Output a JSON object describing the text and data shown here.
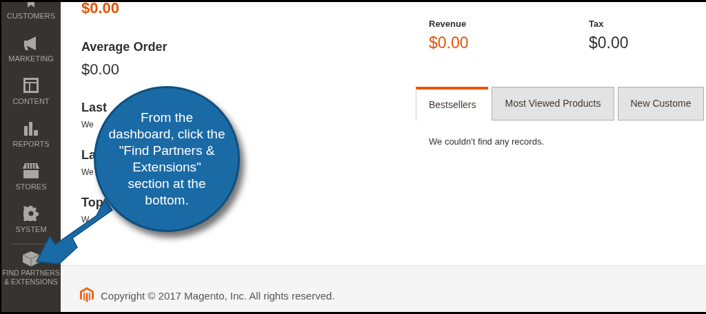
{
  "sidebar": {
    "items": [
      {
        "label": "CUSTOMERS",
        "selected": false
      },
      {
        "label": "MARKETING",
        "selected": false
      },
      {
        "label": "CONTENT",
        "selected": false
      },
      {
        "label": "REPORTS",
        "selected": false
      },
      {
        "label": "STORES",
        "selected": false
      },
      {
        "label": "SYSTEM",
        "selected": false
      }
    ],
    "footer_item": {
      "label": "FIND PARTNERS\n& EXTENSIONS"
    }
  },
  "totals_top": {
    "value": "$0.00"
  },
  "average_order": {
    "title": "Average Order",
    "value": "$0.00"
  },
  "sections": [
    {
      "title": "Last",
      "note": "We"
    },
    {
      "title": "La",
      "note": "We"
    },
    {
      "title": "Top",
      "note": "W"
    }
  ],
  "stats": [
    {
      "label": "Revenue",
      "value": "$0.00",
      "highlight": true
    },
    {
      "label": "Tax",
      "value": "$0.00",
      "highlight": false
    }
  ],
  "tabs": [
    {
      "label": "Bestsellers",
      "selected": true
    },
    {
      "label": "Most Viewed Products",
      "selected": false
    },
    {
      "label": "New Custome",
      "selected": false
    }
  ],
  "tab_content": "We couldn't find any records.",
  "footer": {
    "copyright": "Copyright © 2017 Magento, Inc. All rights reserved."
  },
  "callout": {
    "text": "From the\ndashboard, click the\n\"Find Partners &\nExtensions\"\nsection at the\nbottom."
  }
}
